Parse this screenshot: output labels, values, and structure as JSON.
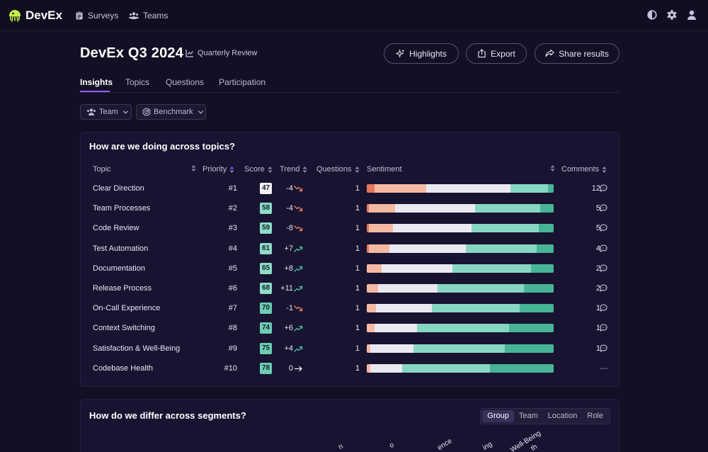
{
  "nav": {
    "brand": "DevEx",
    "links": [
      {
        "label": "Surveys",
        "icon": "clipboard-icon"
      },
      {
        "label": "Teams",
        "icon": "users-icon"
      }
    ],
    "icons": [
      "contrast-icon",
      "gear-icon",
      "user-icon"
    ]
  },
  "header": {
    "title": "DevEx Q3 2024",
    "subtitle": "Quarterly Review",
    "buttons": {
      "highlights": "Highlights",
      "export": "Export",
      "share": "Share results"
    }
  },
  "tabs": [
    "Insights",
    "Topics",
    "Questions",
    "Participation"
  ],
  "active_tab": "Insights",
  "filters": {
    "team": "Team",
    "benchmark": "Benchmark"
  },
  "topics_card": {
    "title": "How are we doing across topics?",
    "columns": {
      "topic": "Topic",
      "priority": "Priority",
      "score": "Score",
      "trend": "Trend",
      "questions": "Questions",
      "sentiment": "Sentiment",
      "comments": "Comments"
    },
    "colors": {
      "strong_neg": "#e2775a",
      "neg": "#f5b8a3",
      "neutral": "#ebe8f1",
      "pos": "#87d6c3",
      "strong_pos": "#47b496",
      "trend_down": "#ee8567",
      "trend_up": "#4fc2a3"
    },
    "rows": [
      {
        "topic": "Clear Direction",
        "priority": "#1",
        "score": "47",
        "trend": "-4",
        "dir": "down",
        "questions": "1",
        "comments": "12",
        "sentiment": [
          4,
          28,
          45,
          20,
          3
        ]
      },
      {
        "topic": "Team Processes",
        "priority": "#2",
        "score": "58",
        "trend": "-4",
        "dir": "down",
        "questions": "1",
        "comments": "5",
        "sentiment": [
          1,
          14,
          43,
          35,
          7
        ]
      },
      {
        "topic": "Code Review",
        "priority": "#3",
        "score": "59",
        "trend": "-8",
        "dir": "down",
        "questions": "1",
        "comments": "5",
        "sentiment": [
          1,
          13,
          42,
          36,
          8
        ]
      },
      {
        "topic": "Test Automation",
        "priority": "#4",
        "score": "61",
        "trend": "+7",
        "dir": "up",
        "questions": "1",
        "comments": "4",
        "sentiment": [
          1,
          11,
          41,
          38,
          9
        ]
      },
      {
        "topic": "Documentation",
        "priority": "#5",
        "score": "65",
        "trend": "+8",
        "dir": "up",
        "questions": "1",
        "comments": "2",
        "sentiment": [
          0,
          8,
          38,
          42,
          12
        ]
      },
      {
        "topic": "Release Process",
        "priority": "#6",
        "score": "68",
        "trend": "+11",
        "dir": "up",
        "questions": "1",
        "comments": "2",
        "sentiment": [
          0,
          6,
          32,
          46,
          16
        ]
      },
      {
        "topic": "On-Call Experience",
        "priority": "#7",
        "score": "70",
        "trend": "-1",
        "dir": "down",
        "questions": "1",
        "comments": "1",
        "sentiment": [
          0,
          5,
          30,
          47,
          18
        ]
      },
      {
        "topic": "Context Switching",
        "priority": "#8",
        "score": "74",
        "trend": "+6",
        "dir": "up",
        "questions": "1",
        "comments": "1",
        "sentiment": [
          0,
          4,
          23,
          49,
          24
        ]
      },
      {
        "topic": "Satisfaction & Well-Being",
        "priority": "#9",
        "score": "75",
        "trend": "+4",
        "dir": "up",
        "questions": "1",
        "comments": "1",
        "sentiment": [
          0,
          2,
          23,
          49,
          26
        ]
      },
      {
        "topic": "Codebase Health",
        "priority": "#10",
        "score": "78",
        "trend": "0",
        "dir": "flat",
        "questions": "1",
        "comments": "—",
        "sentiment": [
          0,
          2,
          17,
          47,
          34
        ]
      }
    ]
  },
  "segments_card": {
    "title": "How do we differ across segments?",
    "options": [
      "Group",
      "Team",
      "Location",
      "Role"
    ],
    "active": "Group",
    "partial_labels": [
      "n",
      "o",
      "ence",
      "ing",
      "Well-Being",
      "th"
    ]
  }
}
